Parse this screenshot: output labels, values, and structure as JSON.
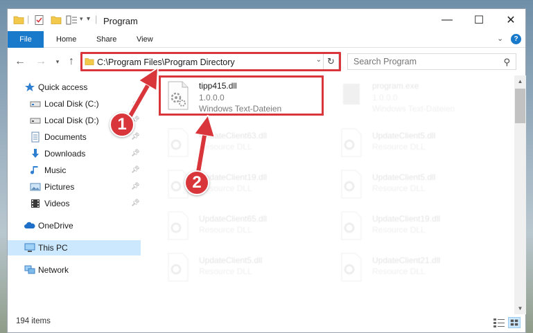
{
  "window": {
    "title": "Program",
    "controls": {
      "minimize": "—",
      "maximize": "☐",
      "close": "✕"
    }
  },
  "ribbon": {
    "tabs": [
      {
        "label": "File"
      },
      {
        "label": "Home"
      },
      {
        "label": "Share"
      },
      {
        "label": "View"
      }
    ],
    "expand_icon": "chevron-down-icon",
    "help_icon": "help-icon"
  },
  "navigation": {
    "address": "C:\\Program Files\\Program Directory",
    "search_placeholder": "Search Program"
  },
  "sidebar": {
    "items": [
      {
        "label": "Quick access",
        "icon": "star-icon",
        "pinned": false
      },
      {
        "label": "Local Disk (C:)",
        "icon": "drive-icon",
        "pinned": true
      },
      {
        "label": "Local Disk (D:)",
        "icon": "drive-icon",
        "pinned": true
      },
      {
        "label": "Documents",
        "icon": "documents-icon",
        "pinned": true
      },
      {
        "label": "Downloads",
        "icon": "downloads-icon",
        "pinned": true
      },
      {
        "label": "Music",
        "icon": "music-icon",
        "pinned": true
      },
      {
        "label": "Pictures",
        "icon": "pictures-icon",
        "pinned": true
      },
      {
        "label": "Videos",
        "icon": "videos-icon",
        "pinned": true
      },
      {
        "label": "OneDrive",
        "icon": "onedrive-icon",
        "pinned": false
      },
      {
        "label": "This PC",
        "icon": "computer-icon",
        "pinned": false,
        "selected": true
      },
      {
        "label": "Network",
        "icon": "network-icon",
        "pinned": false
      }
    ]
  },
  "files": [
    {
      "name": "tipp415.dll",
      "version": "1.0.0.0",
      "type": "Windows Text-Dateien",
      "highlighted": true
    },
    {
      "name": "program.exe",
      "version": "1.0.0.0",
      "type": "Windows Text-Dateien",
      "faded": true
    },
    {
      "name": "UpdateClient63.dll",
      "type": "Resource DLL",
      "faded": true
    },
    {
      "name": "UpdateClient5.dll",
      "type": "Resource DLL",
      "faded": true
    },
    {
      "name": "UpdateClient19.dll",
      "type": "Resource DLL",
      "faded": true
    },
    {
      "name": "UpdateClient5.dll",
      "type": "Resource DLL",
      "faded": true
    },
    {
      "name": "UpdateClient65.dll",
      "type": "Resource DLL",
      "faded": true
    },
    {
      "name": "UpdateClient19.dll",
      "type": "Resource DLL",
      "faded": true
    },
    {
      "name": "UpdateClient5.dll",
      "type": "Resource DLL",
      "faded": true
    },
    {
      "name": "UpdateClient21.dll",
      "type": "Resource DLL",
      "faded": true
    }
  ],
  "status": {
    "item_count": "194 items"
  },
  "annotations": {
    "step1": "1",
    "step2": "2",
    "color": "#d9363b"
  }
}
